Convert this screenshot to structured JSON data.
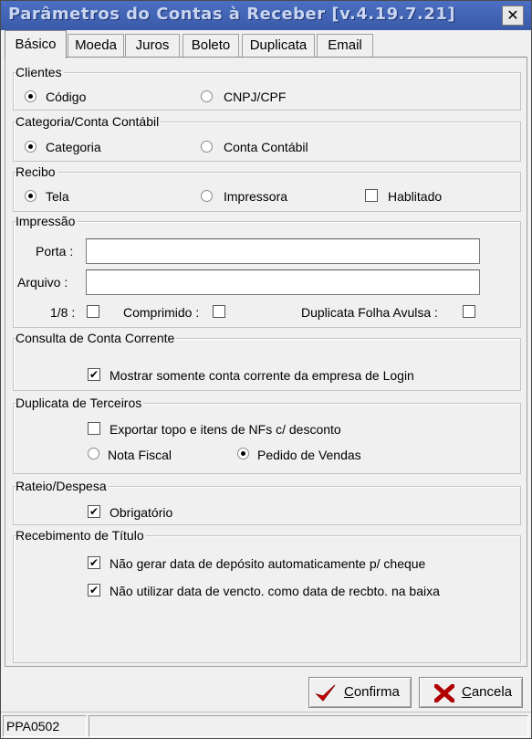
{
  "window": {
    "title": "Parâmetros do Contas à Receber [v.4.19.7.21]",
    "close_glyph": "✕"
  },
  "tabs": [
    {
      "label": "Básico",
      "active": true
    },
    {
      "label": "Moeda",
      "active": false
    },
    {
      "label": "Juros",
      "active": false
    },
    {
      "label": "Boleto",
      "active": false
    },
    {
      "label": "Duplicata",
      "active": false
    },
    {
      "label": "Email",
      "active": false
    }
  ],
  "clientes": {
    "title": "Clientes",
    "option1": {
      "label": "Código",
      "selected": true
    },
    "option2": {
      "label": "CNPJ/CPF",
      "selected": false
    }
  },
  "categoria": {
    "title": "Categoria/Conta Contábil",
    "option1": {
      "label": "Categoria",
      "selected": true
    },
    "option2": {
      "label": "Conta Contábil",
      "selected": false
    }
  },
  "recibo": {
    "title": "Recibo",
    "option1": {
      "label": "Tela",
      "selected": true
    },
    "option2": {
      "label": "Impressora",
      "selected": false
    },
    "habilitado": {
      "label": "Hablitado",
      "checked": false
    }
  },
  "impressao": {
    "title": "Impressão",
    "porta": {
      "label": "Porta :",
      "value": ""
    },
    "arquivo": {
      "label": "Arquivo :",
      "value": ""
    },
    "oitavo": {
      "label": "1/8 :",
      "checked": false
    },
    "comprimido": {
      "label": "Comprimido :",
      "checked": false
    },
    "folha_avulsa": {
      "label": "Duplicata Folha Avulsa :",
      "checked": false
    }
  },
  "consulta": {
    "title": "Consulta de Conta Corrente",
    "mostrar": {
      "label": "Mostrar somente conta corrente da empresa de Login",
      "checked": true
    }
  },
  "terceiros": {
    "title": "Duplicata de Terceiros",
    "exportar": {
      "label": "Exportar topo e itens de NFs c/ desconto",
      "checked": false
    },
    "option1": {
      "label": "Nota Fiscal",
      "selected": false
    },
    "option2": {
      "label": "Pedido de Vendas",
      "selected": true
    }
  },
  "rateio": {
    "title": "Rateio/Despesa",
    "obrigatorio": {
      "label": "Obrigatório",
      "checked": true
    }
  },
  "recebimento": {
    "title": "Recebimento de Título",
    "nao_gerar": {
      "label": "Não gerar data de depósito automaticamente p/ cheque",
      "checked": true
    },
    "nao_utilizar": {
      "label": "Não utilizar data de vencto. como data de recbto. na baixa",
      "checked": true
    }
  },
  "buttons": {
    "confirma": {
      "label": "Confirma",
      "icon": "checkmark-icon",
      "color": "#d40000"
    },
    "cancela": {
      "label": "Cancela",
      "icon": "x-icon",
      "color": "#b00000"
    }
  },
  "status": {
    "code": "PPA0502",
    "message": ""
  }
}
